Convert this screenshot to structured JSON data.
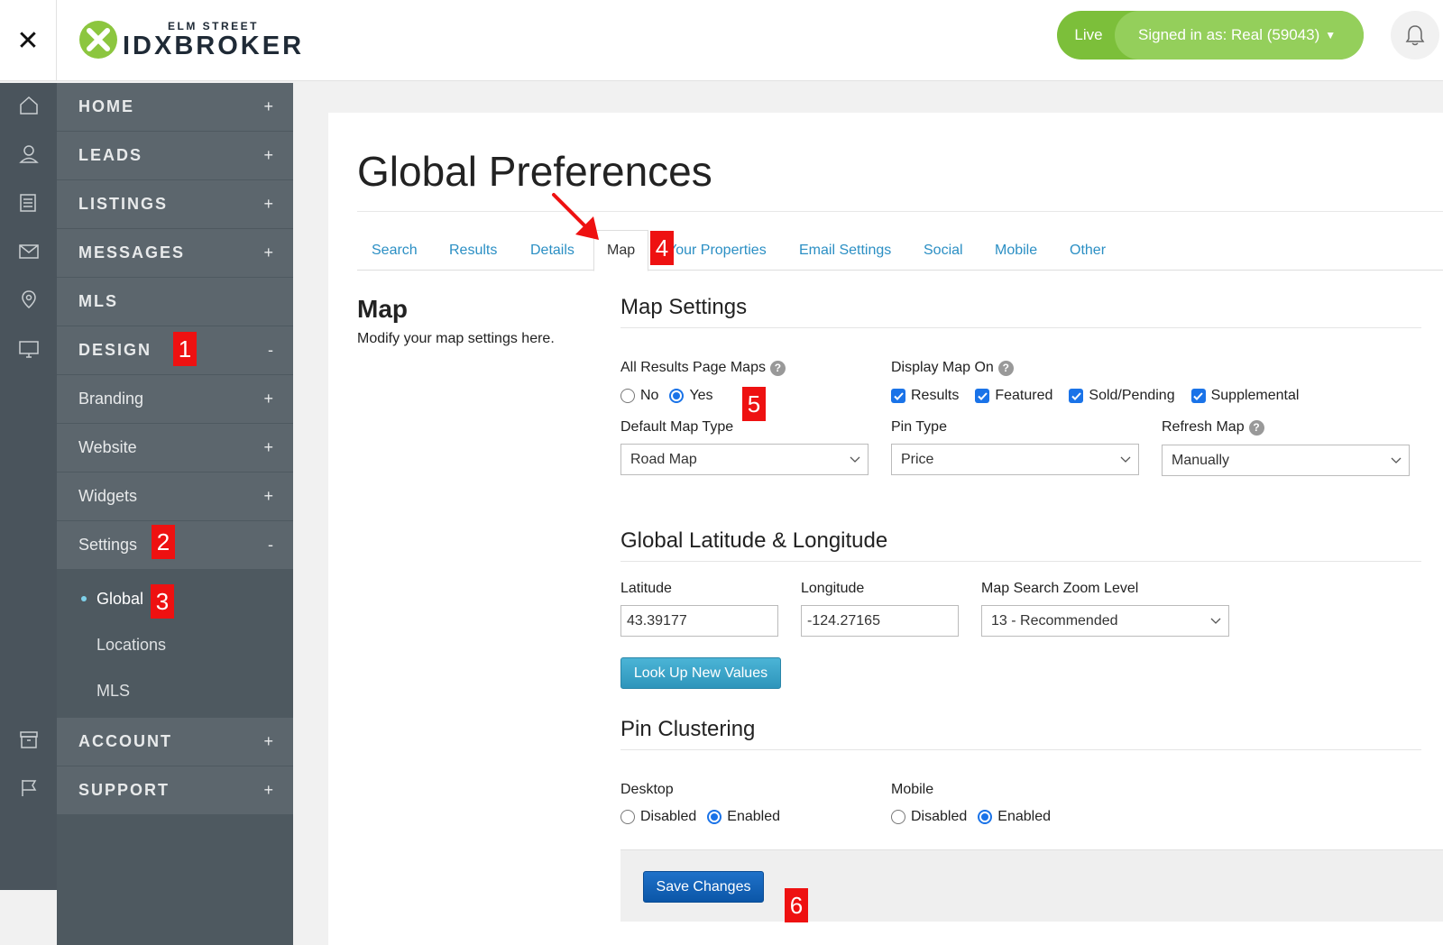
{
  "header": {
    "close_symbol": "✕",
    "logo_small": "ELM STREET",
    "logo_idx": "IDX",
    "logo_broker": "BROKER",
    "live_label": "Live",
    "signed_in": "Signed in as: Real (59043)"
  },
  "nav": {
    "home": "HOME",
    "leads": "LEADS",
    "listings": "LISTINGS",
    "messages": "MESSAGES",
    "mls": "MLS",
    "design": "DESIGN",
    "branding": "Branding",
    "website": "Website",
    "widgets": "Widgets",
    "settings": "Settings",
    "global": "Global",
    "locations": "Locations",
    "mls_sub": "MLS",
    "account": "ACCOUNT",
    "support": "SUPPORT",
    "plus": "+",
    "minus": "-"
  },
  "badges": [
    "1",
    "2",
    "3",
    "4",
    "5",
    "6"
  ],
  "page": {
    "title": "Global Preferences",
    "tabs": [
      "Search",
      "Results",
      "Details",
      "Map",
      "Your Properties",
      "Email Settings",
      "Social",
      "Mobile",
      "Other"
    ],
    "section_title": "Map",
    "section_sub": "Modify your map settings here."
  },
  "map_settings": {
    "heading": "Map Settings",
    "all_results_label": "All Results Page Maps",
    "radio_no": "No",
    "radio_yes": "Yes",
    "display_map_on": "Display Map On",
    "checks": [
      "Results",
      "Featured",
      "Sold/Pending",
      "Supplemental"
    ],
    "default_map_type_label": "Default Map Type",
    "default_map_type_value": "Road Map",
    "pin_type_label": "Pin Type",
    "pin_type_value": "Price",
    "refresh_map_label": "Refresh Map",
    "refresh_map_value": "Manually"
  },
  "latlng": {
    "heading": "Global Latitude & Longitude",
    "latitude_label": "Latitude",
    "latitude_value": "43.39177",
    "longitude_label": "Longitude",
    "longitude_value": "-124.27165",
    "zoom_label": "Map Search Zoom Level",
    "zoom_value": "13 - Recommended",
    "lookup_button": "Look Up New Values"
  },
  "pin_clustering": {
    "heading": "Pin Clustering",
    "desktop_label": "Desktop",
    "mobile_label": "Mobile",
    "disabled": "Disabled",
    "enabled": "Enabled"
  },
  "save_button": "Save Changes",
  "colors": {
    "accent_green": "#7cbf3a",
    "nav_bg": "#5c666d",
    "link_blue": "#2b8fc4",
    "badge_red": "#ee1111"
  }
}
